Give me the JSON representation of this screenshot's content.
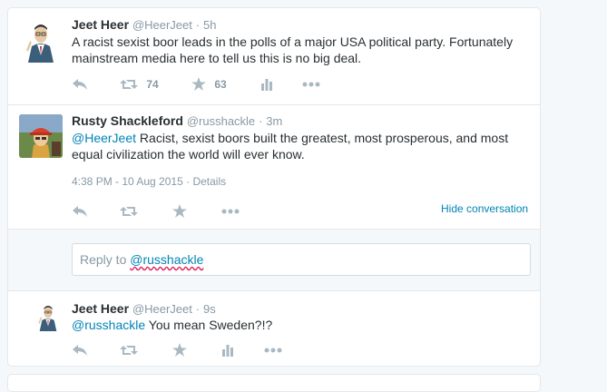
{
  "tweets": [
    {
      "fullname": "Jeet Heer",
      "username": "@HeerJeet",
      "separator": "·",
      "time": "5h",
      "text_line1": "A racist sexist boor leads in the polls of a major USA political party. Fortunately",
      "text_line2": "mainstream media here to tell us this is no big deal.",
      "retweets": "74",
      "favorites": "63"
    },
    {
      "fullname": "Rusty Shackleford",
      "username": "@russhackle",
      "separator": "·",
      "time": "3m",
      "mention": "@HeerJeet",
      "text_line1": " Racist, sexist boors built the greatest, most prosperous, and most",
      "text_line2": "equal civilization the world will ever know.",
      "timestamp": "4:38 PM - 10 Aug 2015",
      "details_sep": " · ",
      "details": "Details",
      "hide_conversation": "Hide conversation"
    },
    {
      "fullname": "Jeet Heer",
      "username": "@HeerJeet",
      "separator": "·",
      "time": "9s",
      "mention": "@russhackle",
      "text_line1": " You mean Sweden?!?"
    }
  ],
  "reply": {
    "prefix": "Reply to ",
    "handle": "@russhackle"
  },
  "icons": [
    "reply-icon",
    "retweet-icon",
    "favorite-icon",
    "analytics-icon",
    "more-icon"
  ],
  "colors": {
    "link": "#0084b4",
    "icon": "#aab8c2",
    "meta": "#8899a6",
    "text": "#292f33"
  }
}
